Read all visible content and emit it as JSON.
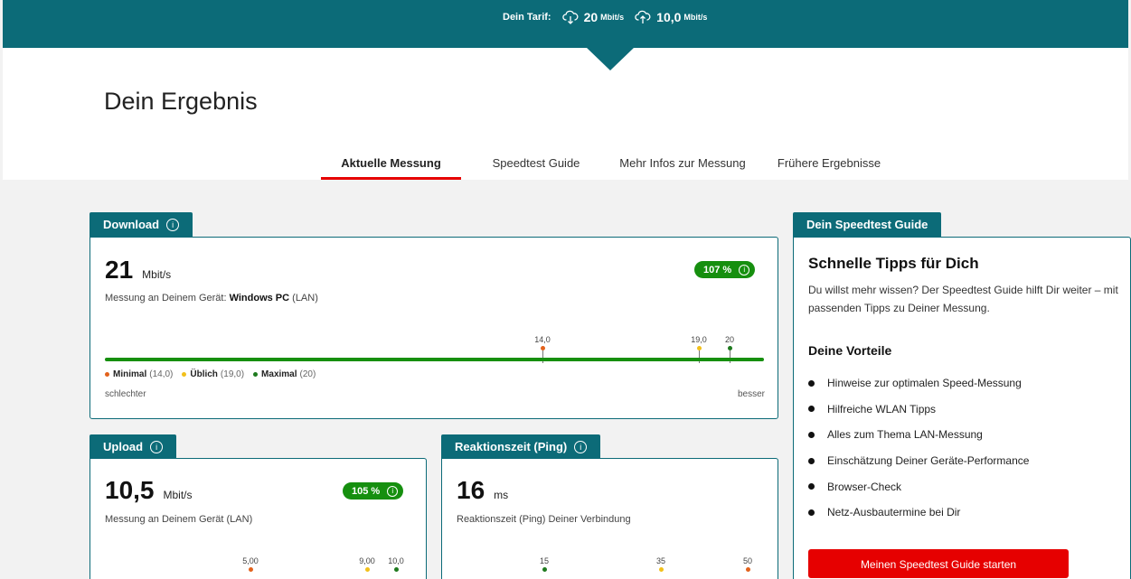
{
  "tarif": {
    "label": "Dein Tarif:",
    "download_value": "20",
    "download_unit": "Mbit/s",
    "upload_value": "10,0",
    "upload_unit": "Mbit/s",
    "download_icon": "cloud-download-icon",
    "upload_icon": "cloud-upload-icon"
  },
  "page": {
    "title": "Dein Ergebnis"
  },
  "tabs": [
    {
      "label": "Aktuelle Messung",
      "active": true
    },
    {
      "label": "Speedtest Guide",
      "active": false
    },
    {
      "label": "Mehr Infos zur Messung",
      "active": false
    },
    {
      "label": "Frühere Ergebnisse",
      "active": false
    }
  ],
  "colors": {
    "brand_teal": "#0c6b78",
    "accent_red": "#e60000",
    "good_green": "#168f0f",
    "minimal_orange": "#e2621c",
    "ueblich_yellow": "#f2c01a",
    "maximal_green": "#1e7a1e"
  },
  "download": {
    "tab_label": "Download",
    "info_icon": "info-icon",
    "value": "21",
    "unit": "Mbit/s",
    "percent": "107 %",
    "measure_prefix": "Messung an Deinem Gerät: ",
    "device": "Windows PC",
    "connection": " (LAN)",
    "markers": {
      "minimal": "14,0",
      "ueblich": "19,0",
      "maximal": "20"
    },
    "legend": {
      "minimal_label": "Minimal",
      "minimal_value": "(14,0)",
      "ueblich_label": "Üblich",
      "ueblich_value": "(19,0)",
      "maximal_label": "Maximal",
      "maximal_value": "(20)"
    },
    "scale_left": "schlechter",
    "scale_right": "besser"
  },
  "upload": {
    "tab_label": "Upload",
    "value": "10,5",
    "unit": "Mbit/s",
    "percent": "105 %",
    "measure_text": "Messung an Deinem Gerät (LAN)",
    "markers": {
      "minimal": "5,00",
      "ueblich": "9,00",
      "maximal": "10,0"
    }
  },
  "ping": {
    "tab_label": "Reaktionszeit (Ping)",
    "value": "16",
    "unit": "ms",
    "measure_text": "Reaktionszeit (Ping) Deiner Verbindung",
    "markers": {
      "minimal": "15",
      "ueblich": "35",
      "maximal": "50"
    }
  },
  "guide": {
    "tab_label": "Dein Speedtest Guide",
    "title": "Schnelle Tipps für Dich",
    "description": "Du willst mehr wissen? Der Speedtest Guide hilft Dir weiter – mit passenden Tipps zu Deiner Messung.",
    "subtitle": "Deine Vorteile",
    "items": [
      "Hinweise zur optimalen Speed-Messung",
      "Hilfreiche WLAN Tipps",
      "Alles zum Thema LAN-Messung",
      "Einschätzung Deiner Geräte-Performance",
      "Browser-Check",
      "Netz-Ausbautermine bei Dir"
    ],
    "button_label": "Meinen Speedtest Guide starten"
  }
}
